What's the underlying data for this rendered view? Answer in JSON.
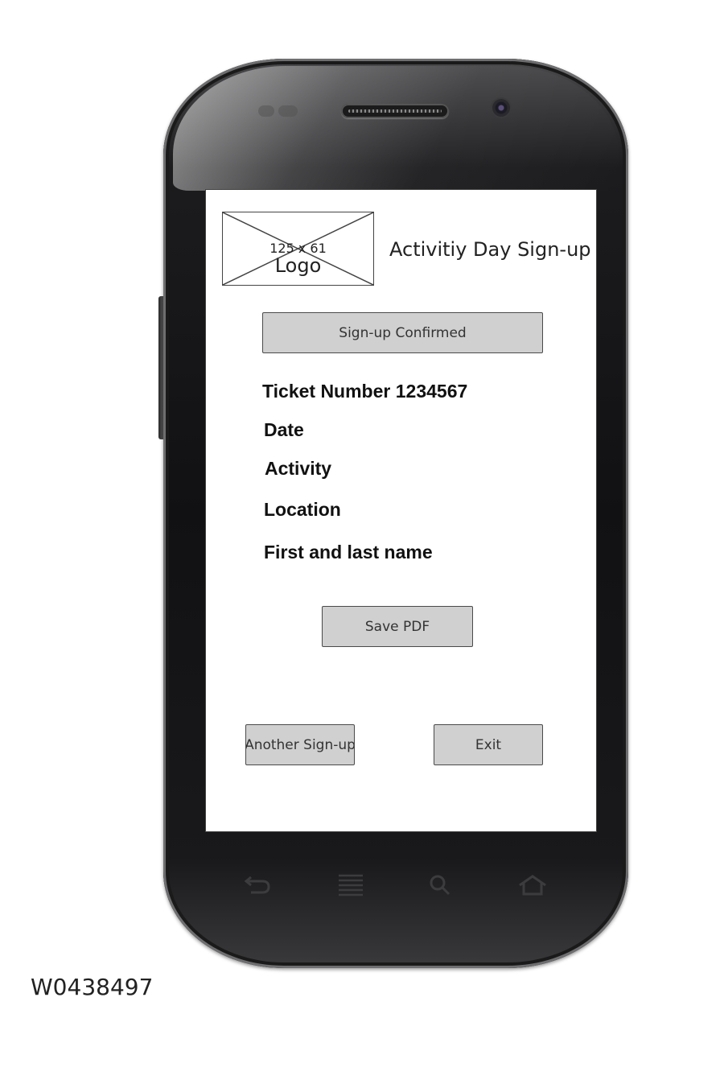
{
  "header": {
    "logo_dimensions": "125 x 61",
    "logo_label": "Logo",
    "title": "Activitiy Day Sign-up"
  },
  "status": {
    "confirmation_label": "Sign-up Confirmed"
  },
  "details": {
    "ticket": "Ticket Number 1234567",
    "date": "Date",
    "activity": "Activity",
    "location": "Location",
    "name": "First and last name"
  },
  "actions": {
    "save_pdf_label": "Save PDF",
    "another_signup_label": "Another Sign-up",
    "exit_label": "Exit"
  },
  "device": {
    "nav_icons": [
      "back-icon",
      "menu-icon",
      "search-icon",
      "home-icon"
    ]
  },
  "caption": "W0438497"
}
